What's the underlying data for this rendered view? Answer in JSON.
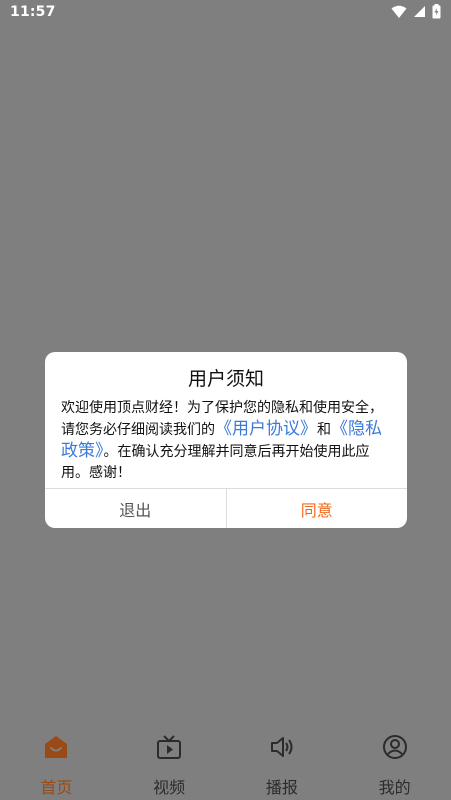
{
  "status_bar": {
    "time": "11:57",
    "icons": [
      "wifi-icon",
      "signal-icon",
      "battery-charging-icon"
    ]
  },
  "dialog": {
    "title": "用户须知",
    "body": {
      "text1": "欢迎使用顶点财经！为了保护您的隐私和使用安全，请您务必仔细阅读我们的",
      "link1": "《用户协议》",
      "text2": "和",
      "link2": "《隐私政策》",
      "text3": "。在确认充分理解并同意后再开始使用此应用。感谢！"
    },
    "buttons": {
      "exit": "退出",
      "agree": "同意"
    }
  },
  "tabbar": {
    "tabs": [
      {
        "label": "首页",
        "icon": "home-icon",
        "active": true
      },
      {
        "label": "视频",
        "icon": "tv-icon",
        "active": false
      },
      {
        "label": "播报",
        "icon": "speaker-icon",
        "active": false
      },
      {
        "label": "我的",
        "icon": "profile-icon",
        "active": false
      }
    ]
  },
  "colors": {
    "overlay": "#7f7f7f",
    "accent": "#f26b1d",
    "link": "#3b7ad9"
  }
}
